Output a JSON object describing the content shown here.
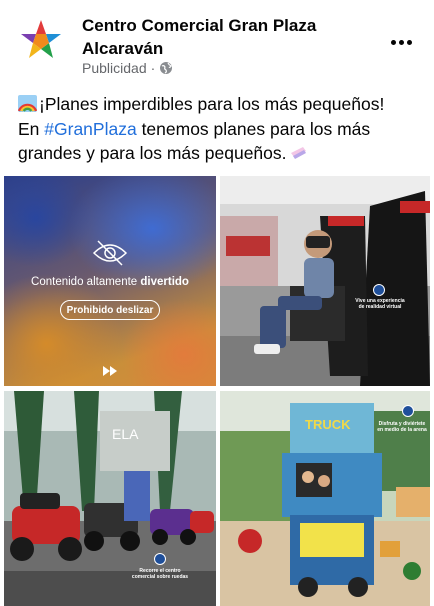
{
  "header": {
    "page_name": "Centro Comercial Gran Plaza Alcaraván",
    "sponsored_label": "Publicidad",
    "separator": "·"
  },
  "post": {
    "line1_text": "¡Planes imperdibles para los más pequeños!",
    "line2_prefix": "En ",
    "hashtag": "#GranPlaza",
    "line2_suffix": " tenemos planes para los más grandes y para los más pequeños."
  },
  "media": {
    "tile1": {
      "warning_text": "Contenido altamente ",
      "warning_bold": "divertido",
      "button_label": "Prohibido deslizar"
    },
    "tile2": {
      "caption": "Vive una experiencia de realidad virtual"
    },
    "tile3": {
      "caption": "Recorre el centro comercial sobre ruedas",
      "sign_letters": "ELA"
    },
    "tile4": {
      "caption": "Disfruta y diviértete en medio de la arena",
      "sign_text": "TRUCK"
    }
  },
  "icons": {
    "logo": "star-logo-icon",
    "globe": "globe-icon",
    "more": "more-options-icon",
    "rainbow": "rainbow-emoji-icon",
    "ticket": "ticket-emoji-icon",
    "eye_off": "eye-off-icon",
    "play": "fast-forward-icon"
  },
  "colors": {
    "text": "#050505",
    "muted": "#65676b",
    "link": "#216fdb",
    "brand_blue": "#1f4f9a"
  }
}
